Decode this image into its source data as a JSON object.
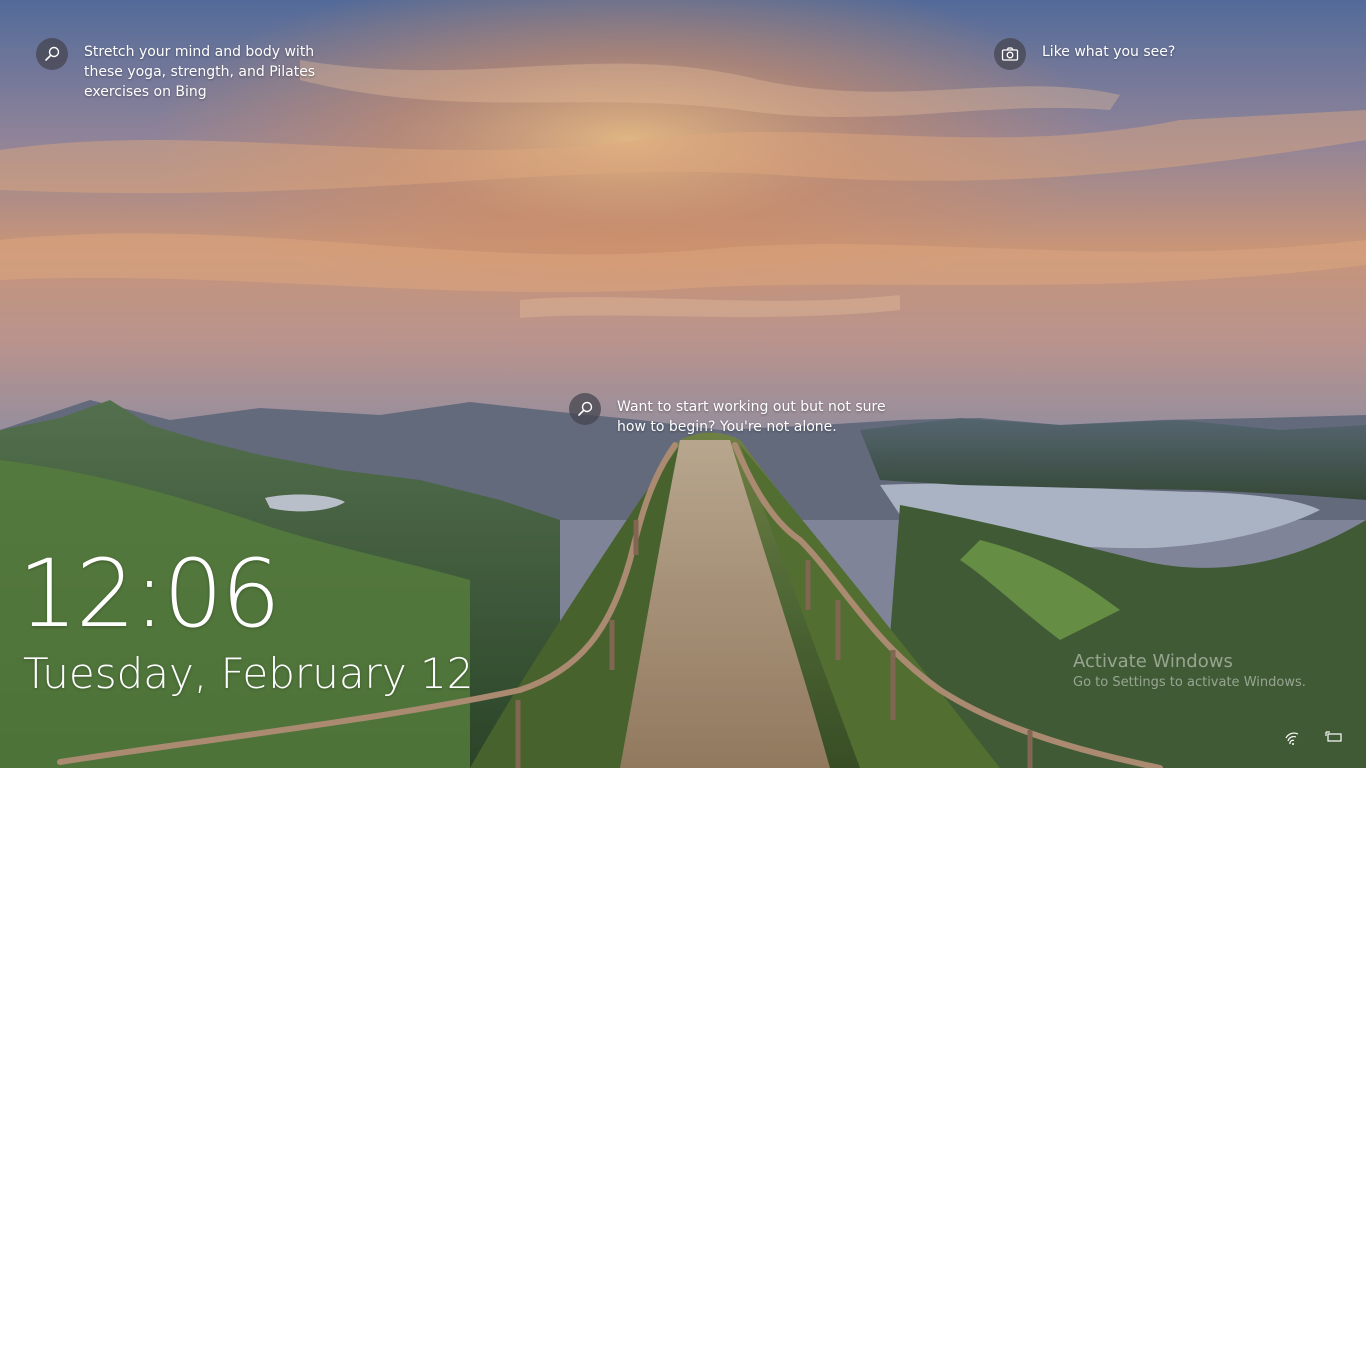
{
  "spotlight": {
    "top_left": {
      "icon": "search-icon",
      "text": "Stretch your mind and body with these yoga, strength, and Pilates exercises on Bing"
    },
    "center": {
      "icon": "search-icon",
      "text": "Want to start working out but not sure how to begin? You're not alone."
    },
    "top_right": {
      "icon": "camera-icon",
      "text": "Like what you see?"
    }
  },
  "clock": {
    "time": "12:06",
    "date": "Tuesday, February 12"
  },
  "watermark": {
    "title": "Activate Windows",
    "subtitle": "Go to Settings to activate Windows."
  },
  "tray": {
    "network_icon": "network-icon",
    "power_icon": "power-icon"
  },
  "colors": {
    "text": "#ffffff",
    "icon_circle": "#46464f"
  }
}
